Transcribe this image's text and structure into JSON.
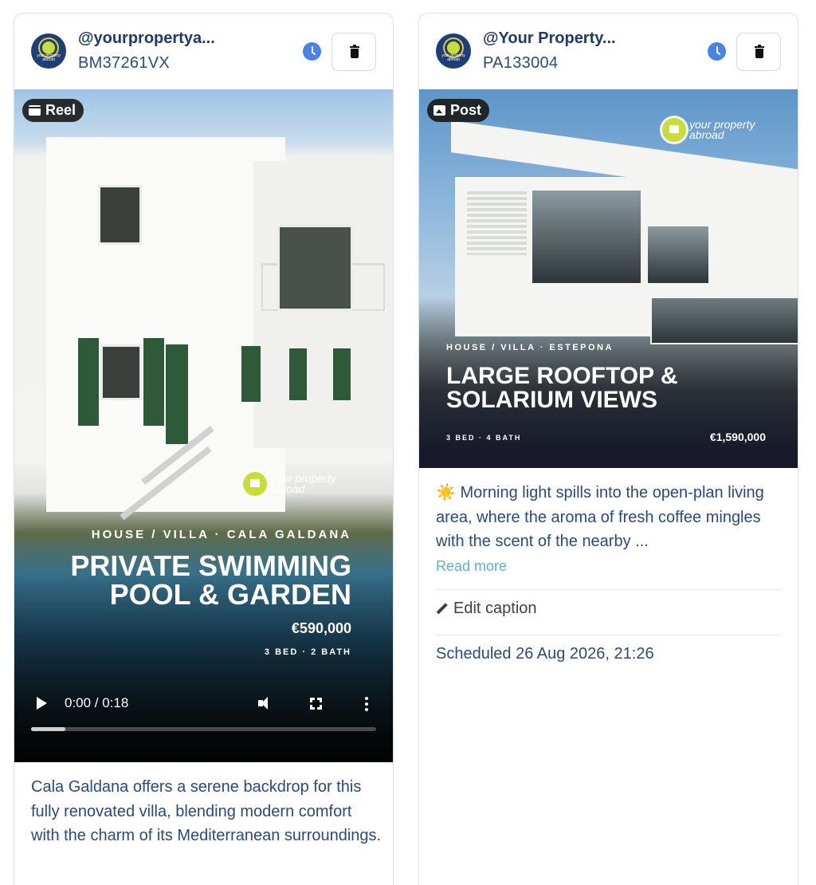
{
  "cards": [
    {
      "handle": "@yourpropertya...",
      "ref": "BM37261VX",
      "type_label": "Reel",
      "avatar_text": "your property abroad",
      "overlay": {
        "brand": "your property abroad",
        "category": "HOUSE / VILLA  ·  CALA GALDANA",
        "title_line1": "PRIVATE SWIMMING",
        "title_line2": "POOL & GARDEN",
        "price": "€590,000",
        "beds": "3 BED  ·  2 BATH"
      },
      "video": {
        "time": "0:00 / 0:18",
        "progress": 0.1
      },
      "caption": "Cala Galdana offers a serene backdrop for this fully renovated villa, blending modern comfort with the charm of its Mediterranean surroundings."
    },
    {
      "handle": "@Your Property...",
      "ref": "PA133004",
      "type_label": "Post",
      "avatar_text": "your property abroad",
      "overlay": {
        "brand": "your property abroad",
        "category": "HOUSE / VILLA  ·  ESTEPONA",
        "title_line1": "LARGE ROOFTOP &",
        "title_line2": "SOLARIUM VIEWS",
        "price": "€1,590,000",
        "beds": "3 BED  ·  4 BATH"
      },
      "caption": "☀️ Morning light spills into the open-plan living area, where the aroma of fresh coffee mingles with the scent of the nearby ...",
      "read_more": "Read more",
      "edit_caption": "Edit caption",
      "scheduled": "Scheduled 26 Aug 2026, 21:26"
    }
  ],
  "colors": {
    "accent_blue": "#4a82e6",
    "link": "#5bb0cc",
    "text_navy": "#2a4a7c"
  }
}
